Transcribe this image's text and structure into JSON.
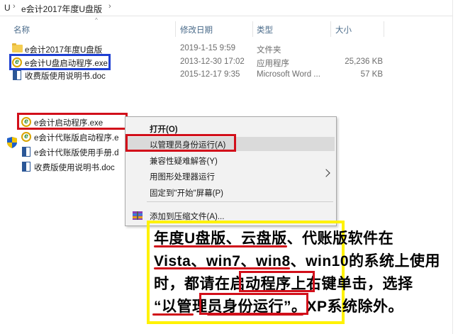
{
  "breadcrumb": {
    "root": "U",
    "current": "e会计2017年度U盘版"
  },
  "headers": {
    "name": "名称",
    "date": "修改日期",
    "type": "类型",
    "size": "大小"
  },
  "files": [
    {
      "name": "e会计2017年度U盘版",
      "date": "2019-1-15 9:59",
      "type": "文件夹",
      "size": "",
      "icon": "folder-icon"
    },
    {
      "name": "e会计U盘启动程序.exe",
      "date": "2013-12-30 17:02",
      "type": "应用程序",
      "size": "25,236 KB",
      "icon": "app-icon"
    },
    {
      "name": "收费版使用说明书.doc",
      "date": "2015-12-17 9:35",
      "type": "Microsoft Word ...",
      "size": "57 KB",
      "icon": "word-doc-icon"
    }
  ],
  "files2": [
    {
      "name": "e会计启动程序.exe",
      "icon": "app-icon"
    },
    {
      "name": "e会计代账版启动程序.e",
      "icon": "app-icon"
    },
    {
      "name": "e会计代账版使用手册.d",
      "icon": "word-doc-icon"
    },
    {
      "name": "收费版使用说明书.doc",
      "icon": "word-doc-icon"
    }
  ],
  "context_menu": {
    "items": [
      {
        "label": "打开(O)"
      },
      {
        "label": "以管理员身份运行(A)"
      },
      {
        "label": "兼容性疑难解答(Y)"
      },
      {
        "label": "用图形处理器运行"
      },
      {
        "label": "固定到\"开始\"屏幕(P)"
      },
      {
        "label": "添加到压缩文件(A)..."
      }
    ]
  },
  "annotation": {
    "lines": [
      "年度U盘版、云盘版、代账版软件在",
      "Vista、win7、win8、win10的系统上使用",
      "时，都请在启动程序上右键单击，选择",
      "“以管理员身份运行”。XP系统除外。"
    ]
  },
  "colors": {
    "highlight_red": "#d20f1a",
    "highlight_blue": "#1e3fd2",
    "note_border": "#fff200",
    "header_text": "#4a6b8a"
  }
}
